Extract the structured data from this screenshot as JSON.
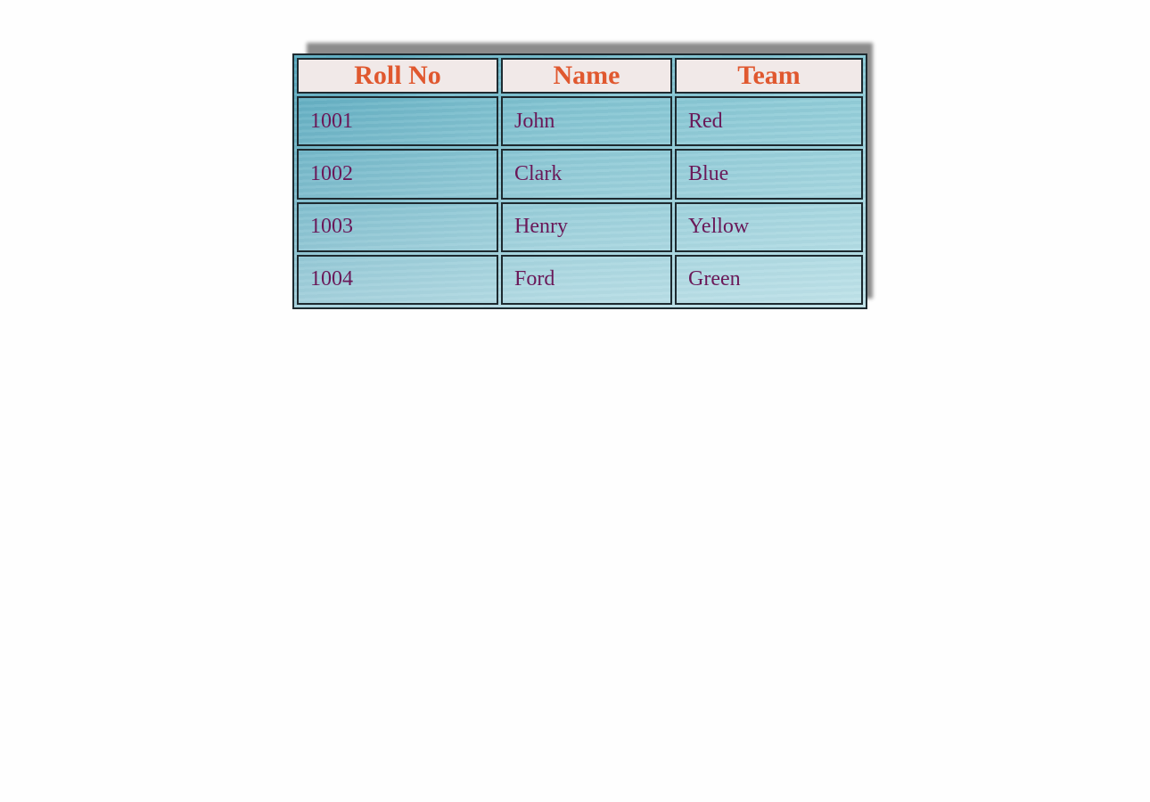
{
  "table": {
    "headers": [
      "Roll No",
      "Name",
      "Team"
    ],
    "rows": [
      [
        "1001",
        "John",
        "Red"
      ],
      [
        "1002",
        "Clark",
        "Blue"
      ],
      [
        "1003",
        "Henry",
        "Yellow"
      ],
      [
        "1004",
        "Ford",
        "Green"
      ]
    ]
  },
  "colors": {
    "header_text": "#e0582f",
    "header_background": "#f1e9e8",
    "cell_text": "#6a1858",
    "border": "#1e2a30",
    "cell_background": "#6fb7c7",
    "shadow": "#8c8c8c"
  }
}
